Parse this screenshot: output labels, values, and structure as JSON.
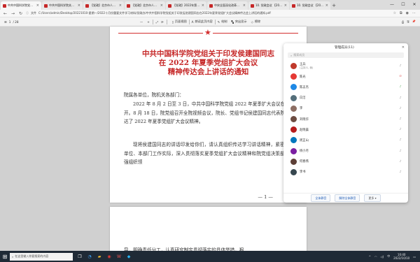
{
  "tabs": [
    {
      "label": "中共中国科学院党组关于印发促进高质量发展...",
      "active": true
    },
    {
      "label": "中共中国科学院关于做好2022年度新闻宣传...",
      "active": false
    },
    {
      "label": "【党政】北京市人民政府网站",
      "active": false
    },
    {
      "label": "【党政】北京市人民政府网站",
      "active": false
    },
    {
      "label": "【党政】2022年第1季度精神文明...",
      "active": false
    },
    {
      "label": "中央全面深化改革委员会第二十次会议",
      "active": false
    },
    {
      "label": "10. 党政会议 【2022】47号 -..",
      "active": false
    },
    {
      "label": "10. 党政会议 【2022】47号 - 中...",
      "active": false
    }
  ],
  "address": {
    "prefix": "文件",
    "url": "C:/Users/admin/Desktop/20221010-星期一/2022十月份重要文件学习材料/党政办/中共中国科学院党组关于印发促进建国同志在2022年夏季党组扩大会议精神传达会上讲话的通知.pdf"
  },
  "pdf_toolbar": {
    "page_label": "/ 28",
    "page_current": "1",
    "items": [
      "页面视图",
      "朗读此页内容",
      "绘制",
      "突出显示",
      "擦除"
    ]
  },
  "document": {
    "title_lines": [
      "中共中国科学院党组关于印发侯建国同志",
      "在 2022 年夏季党组扩大会议",
      "精神传达会上讲话的通知"
    ],
    "addressee": "院属各单位，院机关各部门：",
    "paragraphs": [
      "2022 年 8 月 2 日至 3 日，中共中国科学院党组 2022 年夏季扩大会议在北京召开。8 月 18 日，院党组召开全院视频会议，院长、党组书记侯建国同志代表院党组传达了 2022 年夏季党组扩大会议精神。",
      "现将侯建国同志的讲话印发给你们，请认真组织传达学习讲话精神，紧密结合本单位、本部门工作实际，深入贯彻落实夏季党组扩大会议精神和院党组决策部署，加强组织领"
    ],
    "page_number": "— 1 —",
    "page2_text": "导，明确责任分工，认真研究制定贯彻落实的具体举措，狠"
  },
  "panel": {
    "title": "管理成员(11)",
    "search_placeholder": "搜索成员",
    "members": [
      {
        "name": "王兵",
        "sub": "(主持人, 我)",
        "color": "#c0392b",
        "mic": "on"
      },
      {
        "name": "陈光",
        "color": "#e53935",
        "mic": "off"
      },
      {
        "name": "陈志杰",
        "color": "#1e88e5",
        "mic": "live"
      },
      {
        "name": "白洁",
        "color": "#546e7a",
        "mic": "on"
      },
      {
        "name": "李",
        "color": "#8d6e63",
        "mic": "on"
      },
      {
        "name": "刘晓华",
        "color": "#6d4c41",
        "mic": "on"
      },
      {
        "name": "赵晓晨",
        "color": "#b71c1c",
        "mic": "on"
      },
      {
        "name": "周正山",
        "color": "#0277bd",
        "mic": "on"
      },
      {
        "name": "杨小月",
        "color": "#7b1fa2",
        "mic": "on"
      },
      {
        "name": "何春燕",
        "color": "#5d4037",
        "mic": "on"
      },
      {
        "name": "李书",
        "color": "#37474f",
        "mic": "on"
      }
    ],
    "buttons": [
      "全体静音",
      "解除全体静音",
      "更多"
    ]
  },
  "taskbar": {
    "search_placeholder": "在这里输入你要搜索的内容",
    "time": "10:40",
    "date": "2022/10/10",
    "lang": "中"
  }
}
